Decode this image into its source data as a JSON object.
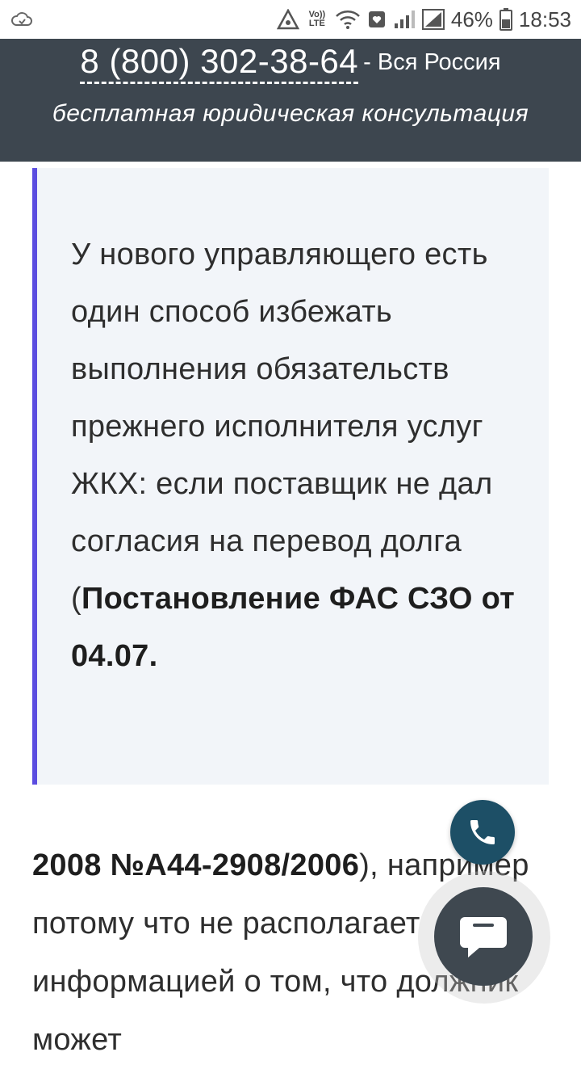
{
  "status_bar": {
    "battery_percent": "46%",
    "time": "18:53",
    "volte_label": "Vo)) LTE",
    "icons": [
      "cloud-icon",
      "data-saver-icon",
      "volte-icon",
      "wifi-icon",
      "heart-icon",
      "signal-icon",
      "signal-icon",
      "battery-icon"
    ]
  },
  "banner": {
    "phone": "8 (800) 302-38-64",
    "phone_suffix": "- Вся Россия",
    "subtitle": "бесплатная юридическая консультация",
    "background": "#3d464f"
  },
  "quote": {
    "text": "У нового управляющего есть один способ избежать выполнения обязательств прежнего исполнителя услуг ЖКХ: если поставщик не дал согласия на перевод долга (",
    "bold": "Постановление ФАС СЗО от 04.07.",
    "accent_color": "#5b4de0"
  },
  "paragraph": {
    "bold": "2008 №А44-2908/2006",
    "text": "), например потому что не располагает информацией о том, что должник может"
  },
  "floating": {
    "call_icon": "phone-icon",
    "chat_icon": "chat-icon"
  }
}
